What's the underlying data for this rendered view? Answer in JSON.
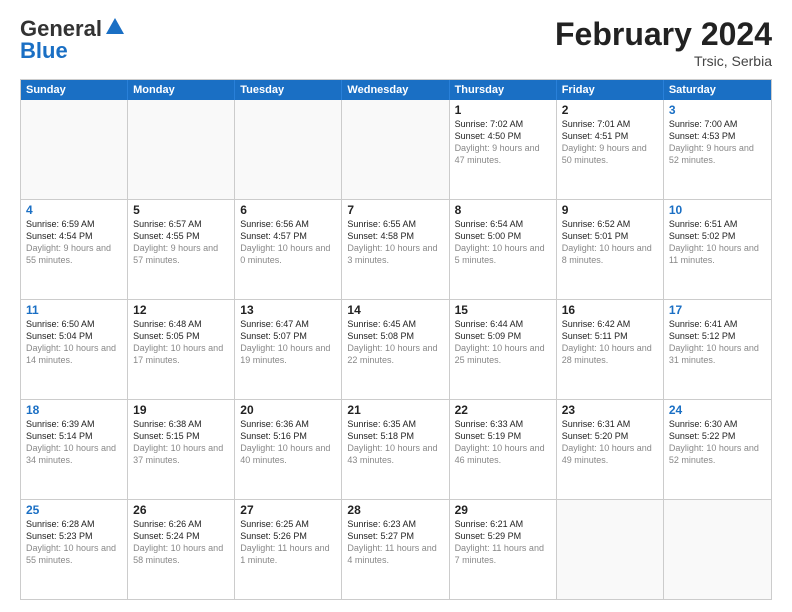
{
  "header": {
    "logo_general": "General",
    "logo_blue": "Blue",
    "month_year": "February 2024",
    "location": "Trsic, Serbia"
  },
  "days_of_week": [
    "Sunday",
    "Monday",
    "Tuesday",
    "Wednesday",
    "Thursday",
    "Friday",
    "Saturday"
  ],
  "weeks": [
    [
      {
        "day": "",
        "empty": true
      },
      {
        "day": "",
        "empty": true
      },
      {
        "day": "",
        "empty": true
      },
      {
        "day": "",
        "empty": true
      },
      {
        "day": "1",
        "sunrise": "7:02 AM",
        "sunset": "4:50 PM",
        "daylight": "9 hours and 47 minutes."
      },
      {
        "day": "2",
        "sunrise": "7:01 AM",
        "sunset": "4:51 PM",
        "daylight": "9 hours and 50 minutes."
      },
      {
        "day": "3",
        "sunrise": "7:00 AM",
        "sunset": "4:53 PM",
        "daylight": "9 hours and 52 minutes."
      }
    ],
    [
      {
        "day": "4",
        "sunrise": "6:59 AM",
        "sunset": "4:54 PM",
        "daylight": "9 hours and 55 minutes.",
        "sun": "sunday"
      },
      {
        "day": "5",
        "sunrise": "6:57 AM",
        "sunset": "4:55 PM",
        "daylight": "9 hours and 57 minutes."
      },
      {
        "day": "6",
        "sunrise": "6:56 AM",
        "sunset": "4:57 PM",
        "daylight": "10 hours and 0 minutes."
      },
      {
        "day": "7",
        "sunrise": "6:55 AM",
        "sunset": "4:58 PM",
        "daylight": "10 hours and 3 minutes."
      },
      {
        "day": "8",
        "sunrise": "6:54 AM",
        "sunset": "5:00 PM",
        "daylight": "10 hours and 5 minutes."
      },
      {
        "day": "9",
        "sunrise": "6:52 AM",
        "sunset": "5:01 PM",
        "daylight": "10 hours and 8 minutes."
      },
      {
        "day": "10",
        "sunrise": "6:51 AM",
        "sunset": "5:02 PM",
        "daylight": "10 hours and 11 minutes.",
        "sun": "saturday"
      }
    ],
    [
      {
        "day": "11",
        "sunrise": "6:50 AM",
        "sunset": "5:04 PM",
        "daylight": "10 hours and 14 minutes.",
        "sun": "sunday"
      },
      {
        "day": "12",
        "sunrise": "6:48 AM",
        "sunset": "5:05 PM",
        "daylight": "10 hours and 17 minutes."
      },
      {
        "day": "13",
        "sunrise": "6:47 AM",
        "sunset": "5:07 PM",
        "daylight": "10 hours and 19 minutes."
      },
      {
        "day": "14",
        "sunrise": "6:45 AM",
        "sunset": "5:08 PM",
        "daylight": "10 hours and 22 minutes."
      },
      {
        "day": "15",
        "sunrise": "6:44 AM",
        "sunset": "5:09 PM",
        "daylight": "10 hours and 25 minutes."
      },
      {
        "day": "16",
        "sunrise": "6:42 AM",
        "sunset": "5:11 PM",
        "daylight": "10 hours and 28 minutes."
      },
      {
        "day": "17",
        "sunrise": "6:41 AM",
        "sunset": "5:12 PM",
        "daylight": "10 hours and 31 minutes.",
        "sun": "saturday"
      }
    ],
    [
      {
        "day": "18",
        "sunrise": "6:39 AM",
        "sunset": "5:14 PM",
        "daylight": "10 hours and 34 minutes.",
        "sun": "sunday"
      },
      {
        "day": "19",
        "sunrise": "6:38 AM",
        "sunset": "5:15 PM",
        "daylight": "10 hours and 37 minutes."
      },
      {
        "day": "20",
        "sunrise": "6:36 AM",
        "sunset": "5:16 PM",
        "daylight": "10 hours and 40 minutes."
      },
      {
        "day": "21",
        "sunrise": "6:35 AM",
        "sunset": "5:18 PM",
        "daylight": "10 hours and 43 minutes."
      },
      {
        "day": "22",
        "sunrise": "6:33 AM",
        "sunset": "5:19 PM",
        "daylight": "10 hours and 46 minutes."
      },
      {
        "day": "23",
        "sunrise": "6:31 AM",
        "sunset": "5:20 PM",
        "daylight": "10 hours and 49 minutes."
      },
      {
        "day": "24",
        "sunrise": "6:30 AM",
        "sunset": "5:22 PM",
        "daylight": "10 hours and 52 minutes.",
        "sun": "saturday"
      }
    ],
    [
      {
        "day": "25",
        "sunrise": "6:28 AM",
        "sunset": "5:23 PM",
        "daylight": "10 hours and 55 minutes.",
        "sun": "sunday"
      },
      {
        "day": "26",
        "sunrise": "6:26 AM",
        "sunset": "5:24 PM",
        "daylight": "10 hours and 58 minutes."
      },
      {
        "day": "27",
        "sunrise": "6:25 AM",
        "sunset": "5:26 PM",
        "daylight": "11 hours and 1 minute."
      },
      {
        "day": "28",
        "sunrise": "6:23 AM",
        "sunset": "5:27 PM",
        "daylight": "11 hours and 4 minutes."
      },
      {
        "day": "29",
        "sunrise": "6:21 AM",
        "sunset": "5:29 PM",
        "daylight": "11 hours and 7 minutes."
      },
      {
        "day": "",
        "empty": true
      },
      {
        "day": "",
        "empty": true
      }
    ]
  ]
}
